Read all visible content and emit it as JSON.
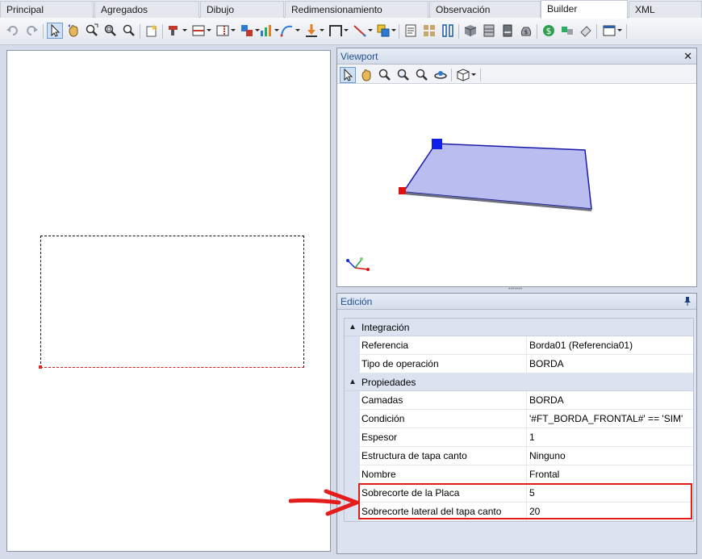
{
  "tabs": [
    {
      "label": "Principal",
      "active": false
    },
    {
      "label": "Agregados",
      "active": false
    },
    {
      "label": "Dibujo",
      "active": false
    },
    {
      "label": "Redimensionamiento",
      "active": false
    },
    {
      "label": "Observación",
      "active": false
    },
    {
      "label": "Builder",
      "active": true
    },
    {
      "label": "XML",
      "active": false
    }
  ],
  "viewport": {
    "title": "Viewport",
    "close_glyph": "✕"
  },
  "edicion": {
    "title": "Edición",
    "categories": [
      {
        "label": "Integración",
        "rows": [
          {
            "name": "Referencia",
            "value": "Borda01 (Referencia01)"
          },
          {
            "name": "Tipo de operación",
            "value": "BORDA"
          }
        ]
      },
      {
        "label": "Propiedades",
        "rows": [
          {
            "name": "Camadas",
            "value": "BORDA"
          },
          {
            "name": "Condición",
            "value": "'#FT_BORDA_FRONTAL#' == 'SIM'"
          },
          {
            "name": "Espesor",
            "value": "1"
          },
          {
            "name": "Estructura de tapa canto",
            "value": "Ninguno"
          },
          {
            "name": "Nombre",
            "value": "Frontal"
          },
          {
            "name": "Sobrecorte de la Placa",
            "value": "5"
          },
          {
            "name": "Sobrecorte lateral del tapa canto",
            "value": "20"
          }
        ]
      }
    ]
  },
  "colors": {
    "highlight": "#e41c1c",
    "plane_fill": "#b9bdf0",
    "plane_edge": "#1a1aa8",
    "handle_blue": "#0f1ee8",
    "handle_red": "#d11"
  }
}
